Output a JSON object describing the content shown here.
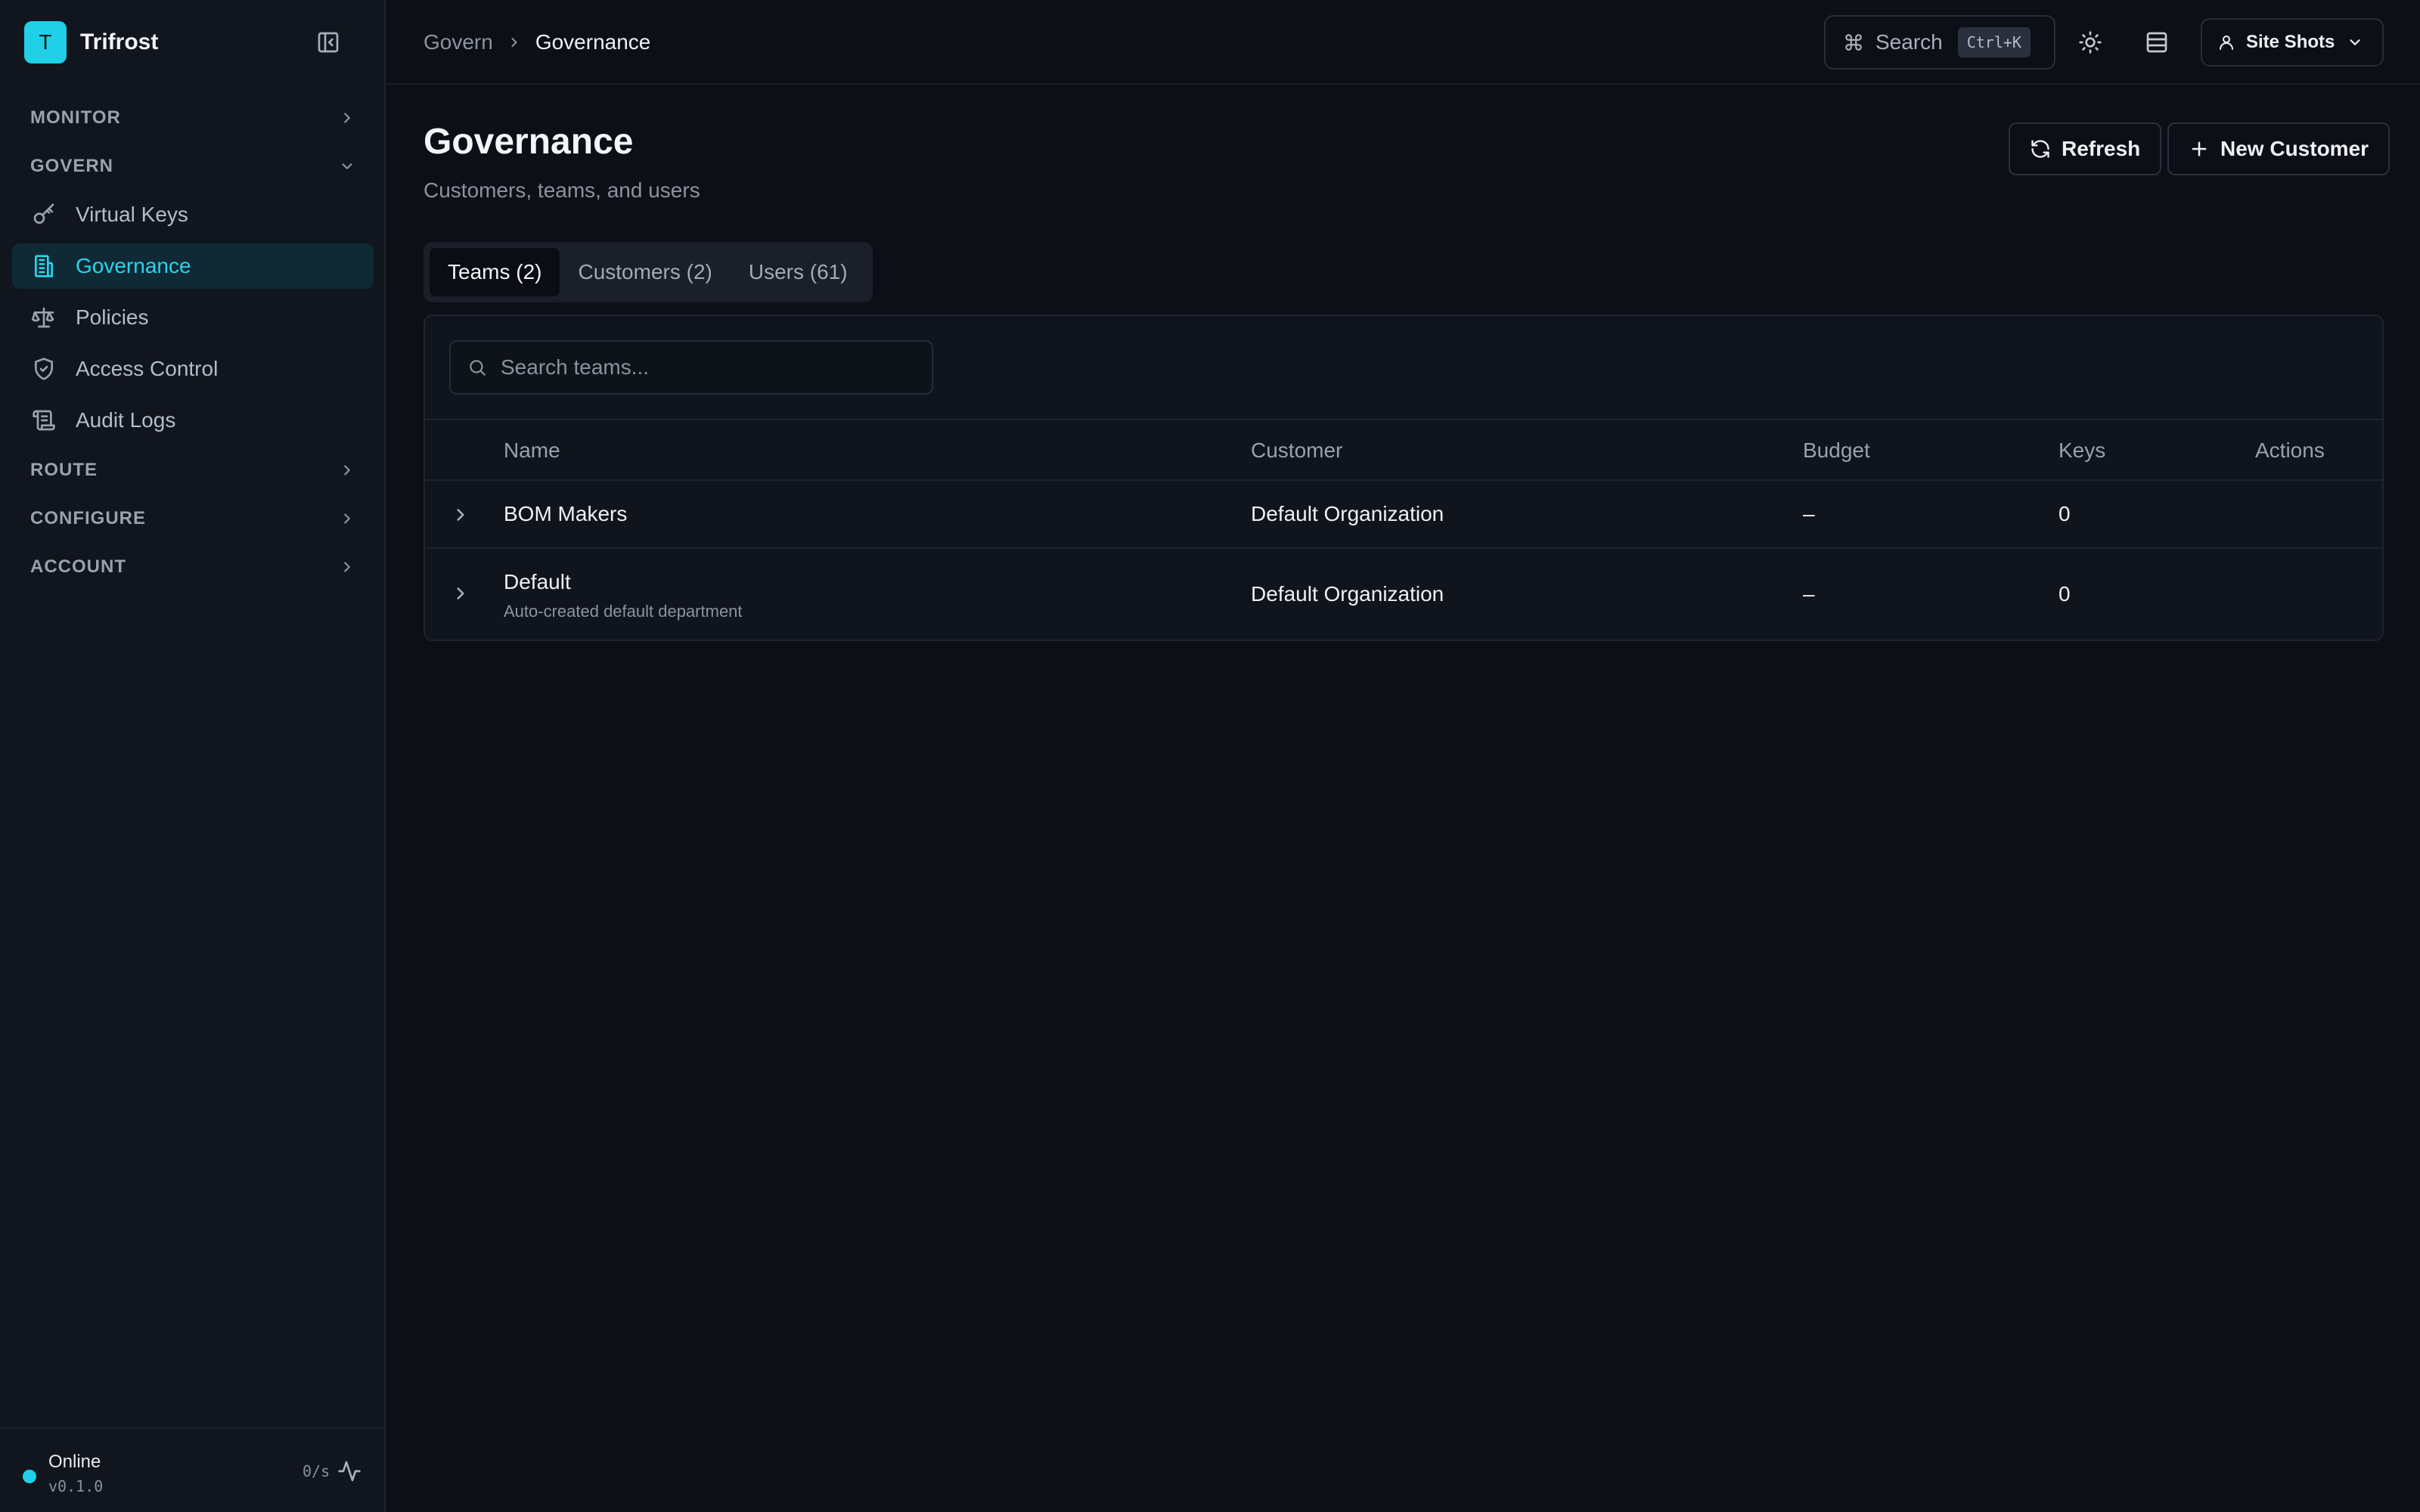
{
  "app": {
    "initial": "T",
    "name": "Trifrost"
  },
  "sidebar": {
    "sections": {
      "monitor": "MONITOR",
      "govern": "GOVERN",
      "route": "ROUTE",
      "configure": "CONFIGURE",
      "account": "ACCOUNT"
    },
    "items": [
      {
        "label": "Virtual Keys",
        "icon": "key-icon"
      },
      {
        "label": "Governance",
        "icon": "building-icon",
        "active": true
      },
      {
        "label": "Policies",
        "icon": "scale-icon"
      },
      {
        "label": "Access Control",
        "icon": "shield-icon"
      },
      {
        "label": "Audit Logs",
        "icon": "scroll-icon"
      }
    ],
    "footer": {
      "status": "Online",
      "version": "v0.1.0",
      "rate": "0/s"
    }
  },
  "header": {
    "breadcrumb": {
      "parent": "Govern",
      "current": "Governance"
    },
    "search": {
      "label": "Search",
      "shortcut": "Ctrl+K"
    },
    "user": {
      "name": "Site Shots"
    }
  },
  "page": {
    "title": "Governance",
    "subtitle": "Customers, teams, and users",
    "refresh_label": "Refresh",
    "new_customer_label": "New Customer"
  },
  "tabs": [
    {
      "label": "Teams (2)",
      "active": true
    },
    {
      "label": "Customers (2)"
    },
    {
      "label": "Users (61)"
    }
  ],
  "table": {
    "search_placeholder": "Search teams...",
    "columns": {
      "name": "Name",
      "customer": "Customer",
      "budget": "Budget",
      "keys": "Keys",
      "actions": "Actions"
    },
    "rows": [
      {
        "name": "BOM Makers",
        "description": "",
        "customer": "Default Organization",
        "budget": "–",
        "keys": "0"
      },
      {
        "name": "Default",
        "description": "Auto-created default department",
        "customer": "Default Organization",
        "budget": "–",
        "keys": "0"
      }
    ]
  },
  "colors": {
    "accent": "#1fd0e6",
    "background": "#0c0f16",
    "sidebar": "#11151d"
  }
}
